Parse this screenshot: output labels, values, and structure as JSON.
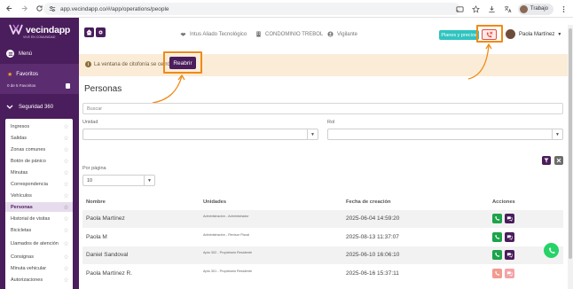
{
  "browser": {
    "url": "app.vecindapp.co/#/app/operations/people",
    "profile_label": "Trabajo"
  },
  "sidebar": {
    "logo_text": "vecindapp",
    "logo_tagline": "VIVE EN COMUNIDAD",
    "menu_label": "Menú",
    "favorites_title": "Favoritos",
    "favorites_count": "0 de 5 Favoritos",
    "section_title": "Seguridad 360",
    "items": [
      {
        "label": "Ingresos"
      },
      {
        "label": "Salidas"
      },
      {
        "label": "Zonas comunes"
      },
      {
        "label": "Botón de pánico"
      },
      {
        "label": "Minutas"
      },
      {
        "label": "Correspondencia"
      },
      {
        "label": "Vehículos"
      },
      {
        "label": "Personas",
        "active": true
      },
      {
        "label": "Historial de visitas"
      },
      {
        "label": "Bicicletas"
      },
      {
        "label": "Llamados de atención"
      },
      {
        "label": "Consignas"
      },
      {
        "label": "Minuta vehicular"
      },
      {
        "label": "Autorizaciones"
      }
    ]
  },
  "header": {
    "partner": "Intus Aliado Tecnológico",
    "condominium": "CONDOMINIO TREBOL",
    "role": "Vigilante",
    "plans_label": "Planes y precios",
    "user_name": "Paola Martínez"
  },
  "banner": {
    "text": "La ventana de citofonía se cerró",
    "reopen_label": "Reabrir"
  },
  "page": {
    "title": "Personas",
    "search_placeholder": "Buscar",
    "unit_label": "Unidad",
    "role_label": "Rol",
    "per_page_label": "Por página",
    "per_page_value": "10"
  },
  "table": {
    "headers": [
      "Nombre",
      "Unidades",
      "Fecha de creación",
      "Acciones"
    ],
    "rows": [
      {
        "name": "Paola Martínez",
        "unit": "Administración - Administrador",
        "date": "2025-06-04 14:59:20",
        "actions": [
          "green",
          "purple"
        ]
      },
      {
        "name": "Paola M",
        "unit": "Administración - Revisor Fiscal",
        "date": "2025-08-13 11:37:07",
        "actions": [
          "green",
          "purple"
        ]
      },
      {
        "name": "Daniel Sandoval",
        "unit": "Apto 302 - Propietario Residente",
        "date": "2025-06-10 16:06:10",
        "actions": [
          "green",
          "purple"
        ]
      },
      {
        "name": "Paola Martínez R.",
        "unit": "Apto 301 - Propietario Residente",
        "date": "2025-06-16 15:37:11",
        "actions": [
          "salmon",
          "pink"
        ]
      }
    ]
  },
  "colors": {
    "brand_purple": "#4a1d5c",
    "accent_teal": "#2fc4c0",
    "highlight_orange": "#f08a14",
    "banner_bg": "#fbecd8",
    "action_green": "#1ea34a",
    "whatsapp_green": "#25d366"
  }
}
